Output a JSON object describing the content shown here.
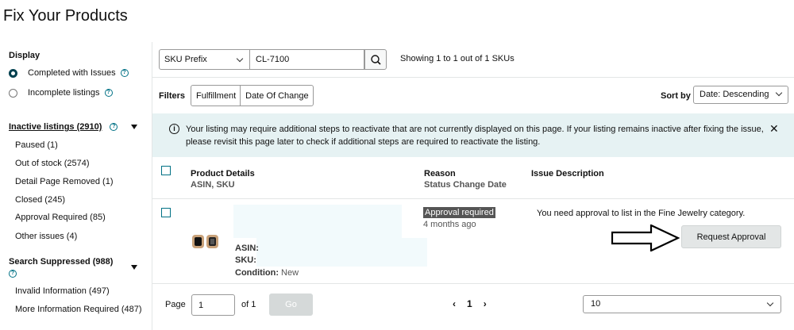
{
  "page_title": "Fix Your Products",
  "sidebar": {
    "display_heading": "Display",
    "display_options": [
      {
        "label": "Completed with Issues",
        "selected": true
      },
      {
        "label": "Incomplete listings",
        "selected": false
      }
    ],
    "inactive": {
      "heading": "Inactive listings (2910)",
      "items": [
        {
          "label": "Paused (1)"
        },
        {
          "label": "Out of stock (2574)"
        },
        {
          "label": "Detail Page Removed (1)"
        },
        {
          "label": "Closed (245)"
        },
        {
          "label": "Approval Required (85)"
        },
        {
          "label": "Other issues (4)"
        }
      ]
    },
    "suppressed": {
      "heading": "Search Suppressed (988)",
      "items": [
        {
          "label": "Invalid Information (497)"
        },
        {
          "label": "More Information Required (487)"
        }
      ]
    }
  },
  "search": {
    "field_select": "SKU Prefix",
    "query": "CL-7100",
    "results_text": "Showing 1 to 1 out of 1 SKUs"
  },
  "filters": {
    "label": "Filters",
    "options": [
      "Fulfillment",
      "Date Of Change"
    ],
    "sort_label": "Sort by",
    "sort_value": "Date: Descending"
  },
  "banner": {
    "text": "Your listing may require additional steps to reactivate that are not currently displayed on this page. If your listing remains inactive after fixing the issue, please revisit this page later to check if additional steps are required to reactivate the listing."
  },
  "table": {
    "headers": {
      "product": "Product Details",
      "product_sub": "ASIN, SKU",
      "reason": "Reason",
      "reason_sub": "Status Change Date",
      "issue": "Issue Description"
    },
    "rows": [
      {
        "asin_label": "ASIN:",
        "sku_label": "SKU:",
        "condition_label": "Condition:",
        "condition_value": "New",
        "reason": "Approval required",
        "date": "4 months ago",
        "issue": "You need approval to list in the Fine Jewelry category.",
        "action": "Request Approval"
      }
    ]
  },
  "pagination": {
    "page_label": "Page",
    "page_value": "1",
    "of_label": "of 1",
    "go_label": "Go",
    "current": "1",
    "per_page": "10"
  }
}
